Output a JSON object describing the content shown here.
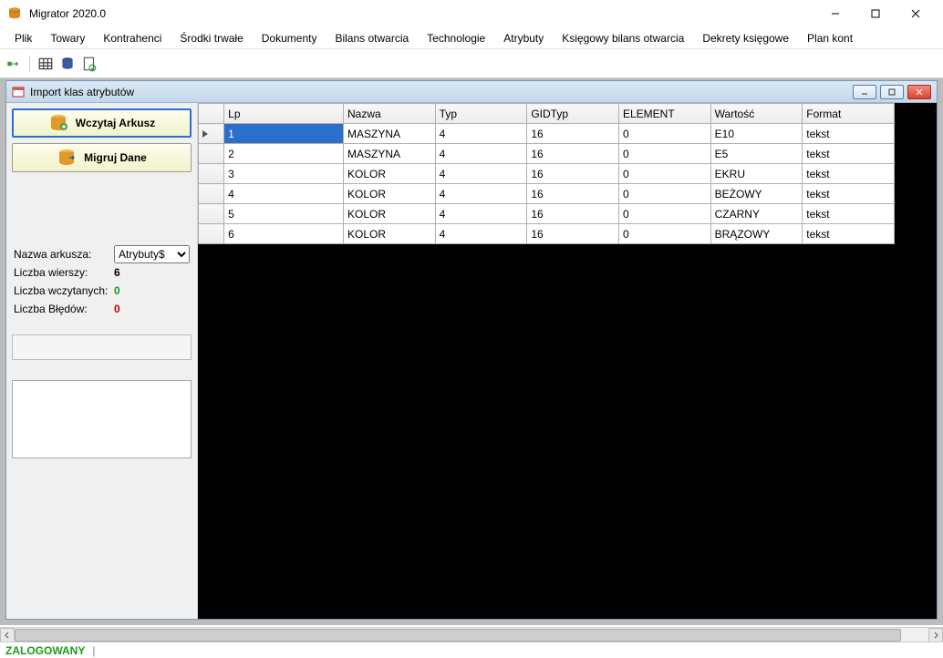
{
  "app": {
    "title": "Migrator 2020.0"
  },
  "menu": [
    "Plik",
    "Towary",
    "Kontrahenci",
    "Środki trwałe",
    "Dokumenty",
    "Bilans otwarcia",
    "Technologie",
    "Atrybuty",
    "Księgowy bilans otwarcia",
    "Dekrety księgowe",
    "Plan kont"
  ],
  "child": {
    "title": "Import klas atrybutów"
  },
  "buttons": {
    "load": "Wczytaj Arkusz",
    "migrate": "Migruj Dane"
  },
  "sheet": {
    "label": "Nazwa arkusza:",
    "value": "Atrybuty$",
    "rows_label": "Liczba wierszy:",
    "rows": "6",
    "loaded_label": "Liczba wczytanych:",
    "loaded": "0",
    "errors_label": "Liczba Błędów:",
    "errors": "0"
  },
  "grid": {
    "headers": [
      "Lp",
      "Nazwa",
      "Typ",
      "GIDTyp",
      "ELEMENT",
      "Wartość",
      "Format"
    ],
    "rows": [
      [
        "1",
        "MASZYNA",
        "4",
        "16",
        "0",
        "E10",
        "tekst"
      ],
      [
        "2",
        "MASZYNA",
        "4",
        "16",
        "0",
        "E5",
        "tekst"
      ],
      [
        "3",
        "KOLOR",
        "4",
        "16",
        "0",
        "EKRU",
        "tekst"
      ],
      [
        "4",
        "KOLOR",
        "4",
        "16",
        "0",
        "BEŻOWY",
        "tekst"
      ],
      [
        "5",
        "KOLOR",
        "4",
        "16",
        "0",
        "CZARNY",
        "tekst"
      ],
      [
        "6",
        "KOLOR",
        "4",
        "16",
        "0",
        "BRĄZOWY",
        "tekst"
      ]
    ]
  },
  "status": {
    "text": "ZALOGOWANY",
    "sep": "|"
  }
}
